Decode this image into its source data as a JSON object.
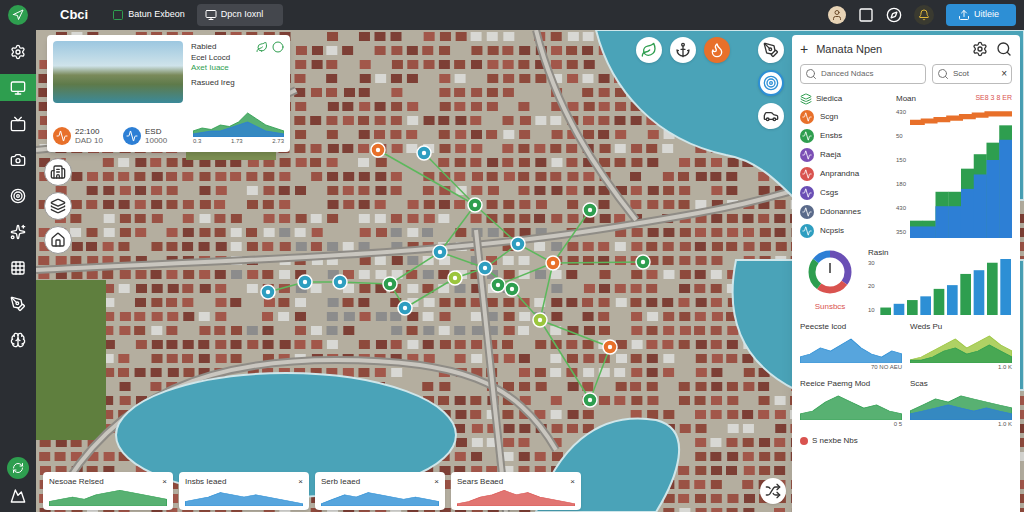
{
  "top_bar": {
    "logo": "Cbci",
    "brand": "Batun Exbeon",
    "tab": "Dpcn Ioxnl",
    "button": "Uitleie"
  },
  "sidebar": {
    "items": [
      {
        "selected": false
      },
      {
        "selected": true
      },
      {
        "selected": false
      },
      {
        "selected": false
      },
      {
        "selected": false
      },
      {
        "selected": false
      },
      {
        "selected": false
      },
      {
        "selected": false
      },
      {
        "selected": false
      }
    ]
  },
  "info_card": {
    "title": "Rabied",
    "subtitle": "Ecel Lcocd",
    "status": "Axet Iuace",
    "chart_label": "Rasued Ireg",
    "stats": [
      {
        "value": "22:100",
        "label": "DAD 10",
        "color": "#e8702a"
      },
      {
        "value": "ESD",
        "label": "10000",
        "color": "#2d7fd5"
      }
    ],
    "chart": {
      "ticks": [
        "0.3",
        "1.73",
        "2.73"
      ],
      "max": 10,
      "series": [
        {
          "color": "#2e9e4f",
          "values": [
            2,
            3,
            2.5,
            4,
            3.5,
            5,
            8,
            6,
            4,
            3,
            2
          ]
        },
        {
          "color": "#2d7fd5",
          "values": [
            1,
            1.5,
            2,
            2,
            3,
            4,
            5,
            3.5,
            2,
            1.5,
            1
          ]
        }
      ]
    }
  },
  "map": {
    "pins": [
      {
        "color": "#e8702a"
      },
      {
        "color": "#2e9ec0"
      },
      {
        "color": "#2e9e4f"
      },
      {
        "color": "#2e9ec0"
      },
      {
        "color": "#2e9ec0"
      },
      {
        "color": "#2e9ec0"
      },
      {
        "color": "#e8702a"
      },
      {
        "color": "#2e9e4f"
      },
      {
        "color": "#2e9e4f"
      },
      {
        "color": "#9bc53d"
      },
      {
        "color": "#2e9e4f"
      },
      {
        "color": "#9bc53d"
      },
      {
        "color": "#e8702a"
      },
      {
        "color": "#2e9e4f"
      },
      {
        "color": "#2e9ec0"
      },
      {
        "color": "#2e9ec0"
      },
      {
        "color": "#2e9ec0"
      },
      {
        "color": "#2e9ec0"
      },
      {
        "color": "#2e9e4f"
      },
      {
        "color": "#2e9e4f"
      }
    ]
  },
  "bottom_cards": [
    {
      "title": "Nesoae Relsed",
      "close": "×",
      "color": "#2e9e4f",
      "values": [
        2,
        3,
        4,
        3,
        5,
        6,
        7,
        6,
        5,
        4,
        3
      ]
    },
    {
      "title": "Insbs Ieaed",
      "close": "×",
      "color": "#2d8fd5",
      "values": [
        2,
        3,
        4,
        6,
        5,
        4,
        5,
        4,
        3,
        2,
        1
      ]
    },
    {
      "title": "Serb Ieaed",
      "close": "×",
      "color": "#2d8fd5",
      "values": [
        1,
        3,
        5,
        4,
        6,
        5,
        4,
        3,
        4,
        3,
        2
      ]
    },
    {
      "title": "Sears Beaed",
      "close": "×",
      "color": "#d9534f",
      "values": [
        1,
        2,
        4,
        5,
        7,
        5,
        6,
        4,
        3,
        2,
        1
      ]
    }
  ],
  "panel": {
    "add": "+",
    "title": "Manata Npen",
    "search_placeholder": "Danced Ndacs",
    "filter": "Scot",
    "clear": "×",
    "list_title": "Siedica",
    "value_title": "Moan",
    "value_reading": "SE8 3 8 ER",
    "items": [
      {
        "name": "Scgn",
        "color": "#e8702a"
      },
      {
        "name": "Ensbs",
        "color": "#2e9e4f"
      },
      {
        "name": "Raeja",
        "color": "#7b4fb5"
      },
      {
        "name": "Anprandna",
        "color": "#d9534f"
      },
      {
        "name": "Csgs",
        "color": "#6a4fb5"
      },
      {
        "name": "Ddonannes",
        "color": "#5a6a8a"
      },
      {
        "name": "Ncpsis",
        "color": "#2e9ec0"
      }
    ],
    "step_chart": {
      "ticks": [
        "430",
        "50",
        "150",
        "180",
        "430",
        "350"
      ],
      "max": 450,
      "series": [
        {
          "kind": "line",
          "color": "#e8702a",
          "values": [
            400,
            405,
            410,
            415,
            420,
            425,
            430,
            430
          ]
        },
        {
          "kind": "area",
          "color": "#2e9e4f",
          "values": [
            60,
            60,
            160,
            160,
            240,
            290,
            330,
            390
          ]
        },
        {
          "kind": "area",
          "color": "#2d7fd5",
          "values": [
            40,
            40,
            110,
            110,
            170,
            220,
            270,
            340
          ]
        }
      ]
    },
    "donut": {
      "label": "Sunsbcs",
      "segments": [
        {
          "color": "#6a4fb5",
          "value": 35
        },
        {
          "color": "#d9534f",
          "value": 25
        },
        {
          "color": "#2e9e4f",
          "value": 25
        },
        {
          "color": "#2d7fd5",
          "value": 15
        }
      ]
    },
    "bar_chart": {
      "title": "Rasin",
      "ticks": [
        "30",
        "20",
        "10"
      ],
      "max": 30,
      "bars": [
        {
          "value": 4,
          "color": "#2e9e4f"
        },
        {
          "value": 6,
          "color": "#2d8fd5"
        },
        {
          "value": 8,
          "color": "#2e9e4f"
        },
        {
          "value": 10,
          "color": "#2d8fd5"
        },
        {
          "value": 14,
          "color": "#2e9e4f"
        },
        {
          "value": 16,
          "color": "#2d8fd5"
        },
        {
          "value": 22,
          "color": "#2e9e4f"
        },
        {
          "value": 24,
          "color": "#2d8fd5"
        },
        {
          "value": 28,
          "color": "#2e9e4f"
        },
        {
          "value": 30,
          "color": "#2d8fd5"
        }
      ]
    },
    "small_charts": [
      {
        "title": "Peecste Icod",
        "tick": "70 NO AEU",
        "max": 10,
        "series": [
          {
            "color": "#2d8fd5",
            "values": [
              2,
              3,
              5,
              4,
              6,
              8,
              5,
              3,
              2,
              4,
              3
            ]
          }
        ]
      },
      {
        "title": "Weds Pu",
        "tick": "1.0 K",
        "max": 10,
        "series": [
          {
            "color": "#9bc53d",
            "values": [
              1,
              2,
              4,
              6,
              8,
              5,
              7,
              9,
              6,
              4
            ]
          },
          {
            "color": "#2e9e4f",
            "values": [
              1,
              1,
              2,
              4,
              5,
              3,
              4,
              6,
              4,
              2
            ]
          }
        ]
      },
      {
        "title": "Reeice Paemg Mod",
        "tick": "0 5",
        "max": 10,
        "series": [
          {
            "color": "#2e9e4f",
            "values": [
              2,
              3,
              6,
              8,
              6,
              4,
              5,
              3,
              2
            ]
          }
        ]
      },
      {
        "title": "Scas",
        "tick": "1.0 K",
        "max": 10,
        "series": [
          {
            "color": "#2e9e4f",
            "values": [
              3,
              5,
              7,
              6,
              8,
              7,
              6,
              5,
              4
            ]
          },
          {
            "color": "#2d7fd5",
            "values": [
              2,
              3,
              4,
              5,
              4,
              3,
              4,
              3,
              2
            ]
          }
        ]
      }
    ],
    "legend": {
      "label": "S nexbe Nbs",
      "color": "#d9534f"
    }
  }
}
